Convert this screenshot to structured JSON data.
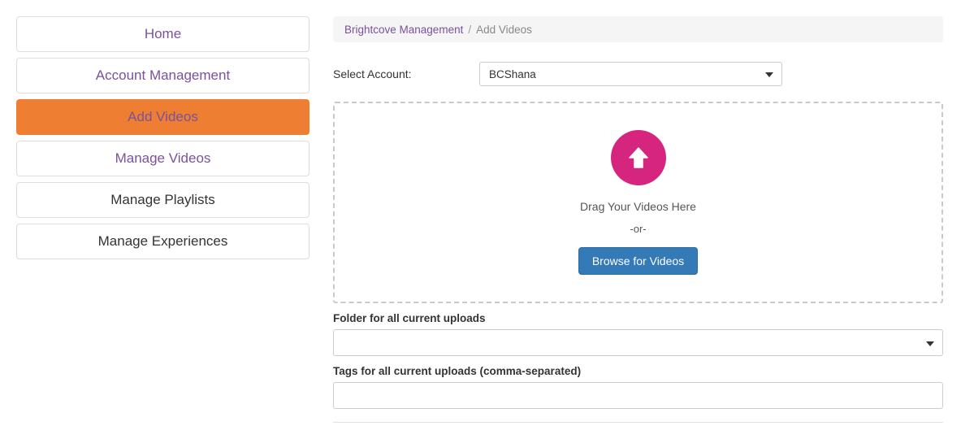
{
  "sidebar": {
    "items": [
      {
        "label": "Home",
        "style": "link",
        "active": false
      },
      {
        "label": "Account Management",
        "style": "link",
        "active": false
      },
      {
        "label": "Add Videos",
        "style": "link",
        "active": true
      },
      {
        "label": "Manage Videos",
        "style": "link",
        "active": false
      },
      {
        "label": "Manage Playlists",
        "style": "plain",
        "active": false
      },
      {
        "label": "Manage Experiences",
        "style": "plain",
        "active": false
      }
    ]
  },
  "breadcrumb": {
    "root": "Brightcove Management",
    "separator": "/",
    "current": "Add Videos"
  },
  "account": {
    "label": "Select Account:",
    "selected": "BCShana"
  },
  "dropzone": {
    "icon": "upload-arrow-icon",
    "drag_text": "Drag Your Videos Here",
    "or_text": "-or-",
    "browse_label": "Browse for Videos"
  },
  "folder_field": {
    "label": "Folder for all current uploads",
    "selected": ""
  },
  "tags_field": {
    "label": "Tags for all current uploads (comma-separated)",
    "value": "",
    "placeholder": ""
  },
  "colors": {
    "accent_orange": "#ee7f32",
    "link_purple": "#7b519d",
    "upload_pink": "#d6257e",
    "button_blue": "#337ab7",
    "breadcrumb_bg": "#f5f5f5",
    "border_gray": "#dddddd"
  }
}
